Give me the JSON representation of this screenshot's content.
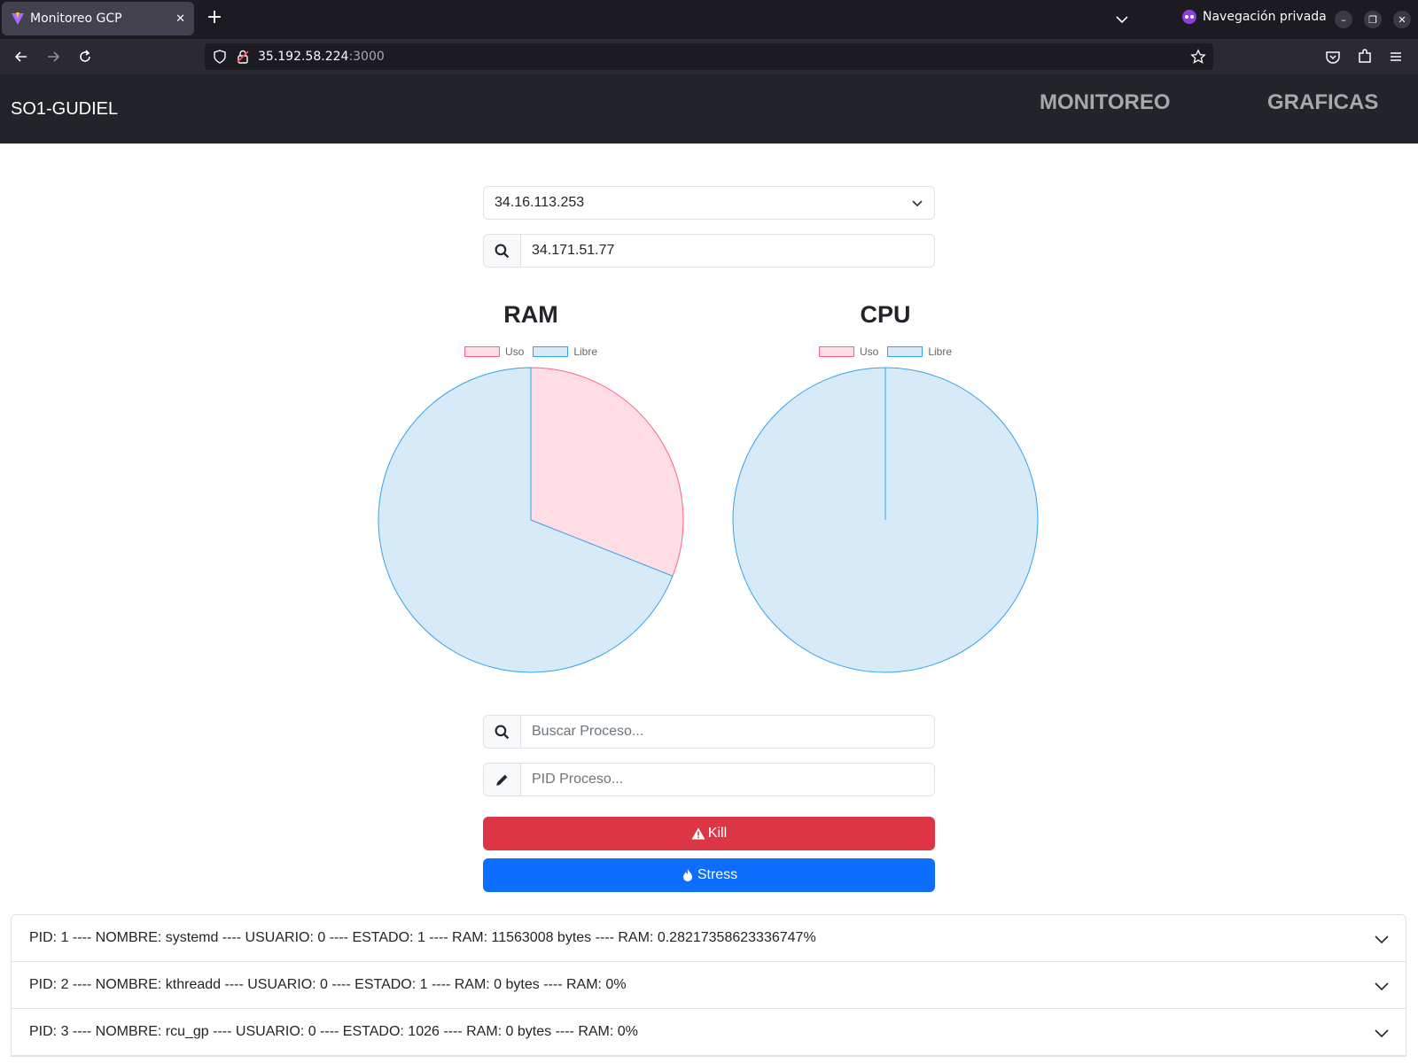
{
  "browser": {
    "tab_title": "Monitoreo GCP",
    "private_label": "Navegación privada",
    "url_host": "35.192.58.224",
    "url_port": ":3000"
  },
  "app": {
    "brand": "SO1-GUDIEL",
    "nav": [
      "MONITOREO",
      "GRAFICAS"
    ]
  },
  "controls": {
    "vm_select_value": "34.16.113.253",
    "ip_search_value": "34.171.51.77",
    "process_search_placeholder": "Buscar Proceso...",
    "pid_placeholder": "PID Proceso..."
  },
  "chart_data": [
    {
      "type": "pie",
      "title": "RAM",
      "labels": [
        "Uso",
        "Libre"
      ],
      "values": [
        31,
        69
      ],
      "colors": {
        "Uso": "#ffdde4",
        "Libre": "#d6eaf8"
      },
      "borders": {
        "Uso": "#ff6384",
        "Libre": "#36a2eb"
      },
      "legend": "top"
    },
    {
      "type": "pie",
      "title": "CPU",
      "labels": [
        "Uso",
        "Libre"
      ],
      "values": [
        0,
        100
      ],
      "colors": {
        "Uso": "#ffdde4",
        "Libre": "#d6eaf8"
      },
      "borders": {
        "Uso": "#ff6384",
        "Libre": "#36a2eb"
      },
      "legend": "top"
    }
  ],
  "buttons": {
    "kill": "Kill",
    "stress": "Stress"
  },
  "processes": [
    "PID: 1 ---- NOMBRE: systemd ---- USUARIO: 0 ---- ESTADO: 1 ---- RAM: 11563008 bytes ---- RAM: 0.28217358623336747%",
    "PID: 2 ---- NOMBRE: kthreadd ---- USUARIO: 0 ---- ESTADO: 1 ---- RAM: 0 bytes ---- RAM: 0%",
    "PID: 3 ---- NOMBRE: rcu_gp ---- USUARIO: 0 ---- ESTADO: 1026 ---- RAM: 0 bytes ---- RAM: 0%"
  ]
}
